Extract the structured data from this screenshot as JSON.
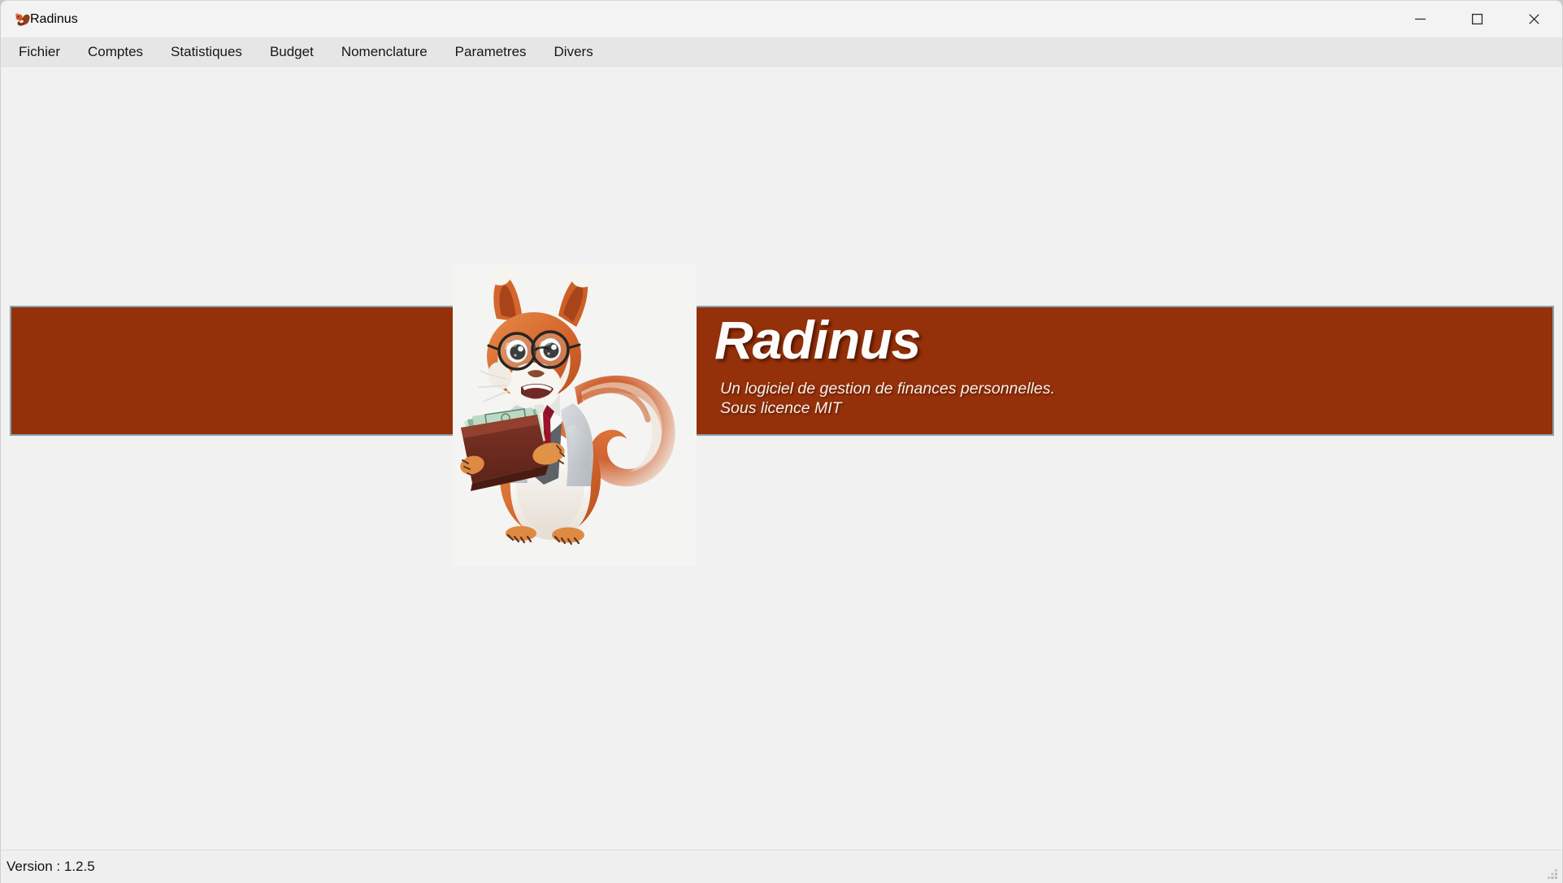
{
  "window": {
    "title": "Radinus",
    "app_icon": "squirrel-icon",
    "controls": {
      "minimize": "minimize-icon",
      "maximize": "maximize-icon",
      "close": "close-icon"
    }
  },
  "menu": {
    "items": [
      {
        "label": "Fichier"
      },
      {
        "label": "Comptes"
      },
      {
        "label": "Statistiques"
      },
      {
        "label": "Budget"
      },
      {
        "label": "Nomenclature"
      },
      {
        "label": "Parametres"
      },
      {
        "label": "Divers"
      }
    ]
  },
  "banner": {
    "title": "Radinus",
    "subtitle_line1": "Un logiciel de gestion de finances personnelles.",
    "subtitle_line2": "Sous licence MIT",
    "background_color": "#94300a",
    "border_color": "#8ca0ab",
    "title_color": "#fdfcfa"
  },
  "mascot": {
    "name": "squirrel-mascot",
    "description": "Squirrel wearing round glasses and a grey suit holding a wallet with banknotes"
  },
  "status_bar": {
    "version_label": "Version : 1.2.5"
  },
  "colors": {
    "titlebar": "#f3f3f3",
    "menubar": "#e6e6e6",
    "content": "#f1f1f1",
    "statusbar": "#efefef",
    "accent": "#94300a"
  }
}
